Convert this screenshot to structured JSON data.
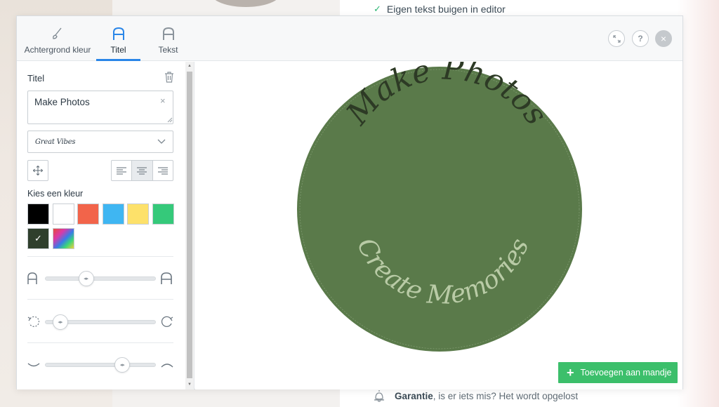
{
  "background": {
    "feature_text": "Eigen tekst buigen in editor",
    "guarantee_bold": "Garantie",
    "guarantee_rest": ", is er iets mis? Het wordt opgelost"
  },
  "tabs": [
    {
      "label": "Achtergrond kleur",
      "icon": "brush-icon",
      "active": false
    },
    {
      "label": "Titel",
      "icon": "letter-a-icon",
      "active": true
    },
    {
      "label": "Tekst",
      "icon": "letter-a-icon",
      "active": false
    }
  ],
  "header_buttons": {
    "expand": "expand-icon",
    "help": "?",
    "close": "×"
  },
  "panel": {
    "title": "Titel",
    "text_value": "Make Photos",
    "clear": "×",
    "font_name": "Great Vibes",
    "align_selected": "center",
    "color_label": "Kies een kleur",
    "colors": [
      "#000000",
      "#ffffff",
      "#f2644a",
      "#3fb6f2",
      "#fde16a",
      "#35c97a",
      "#2f3f2c",
      "gradient"
    ],
    "selected_color_index": 6,
    "check": "✓",
    "size_slider_value": 0.35,
    "rotation_slider_value": 0.08,
    "curve_slider_value": 0.73
  },
  "preview": {
    "circle_color": "#5a7a4a",
    "title_text": "Make Photos",
    "title_color": "#2d3a25",
    "subtitle_text": "Create Memories",
    "subtitle_color": "#b9cba6"
  },
  "cart_button": {
    "label": "Toevoegen aan mandje",
    "icon": "+"
  }
}
